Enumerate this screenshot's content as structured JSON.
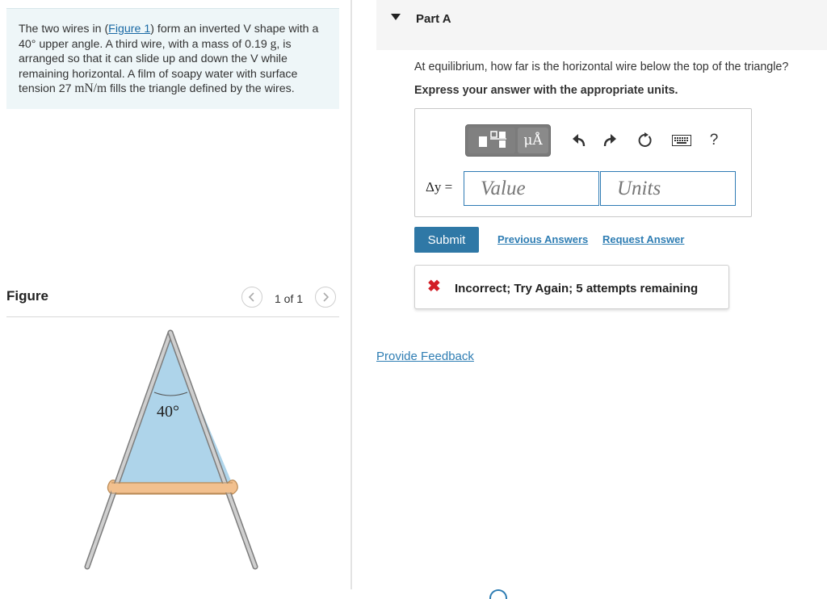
{
  "problem": {
    "text_before_link": "The two wires in (",
    "link_text": "Figure 1",
    "text_after_link": ") form an inverted V shape with a 40° upper angle. A third wire, with a mass of 0.19 ",
    "mass_unit": "g",
    "text_mid": ", is arranged so that it can slide up and down the V while remaining horizontal. A film of soapy water with surface tension 27 ",
    "tension_unit": "mN/m",
    "text_end": " fills the triangle defined by the wires."
  },
  "figure": {
    "title": "Figure",
    "pager": "1 of 1",
    "prev_icon": "chevron-left-icon",
    "next_icon": "chevron-right-icon",
    "angle_label": "40°",
    "colors": {
      "film": "#aed4ea",
      "wire": "#8c8c8c",
      "horizontal_wire": "#f2c08e"
    }
  },
  "part": {
    "title": "Part A",
    "question": "At equilibrium, how far is the horizontal wire below the top of the triangle?",
    "instruction": "Express your answer with the appropriate units."
  },
  "toolbar": {
    "template_icon": "templates-icon",
    "units_button": "μÅ",
    "undo_icon": "undo-icon",
    "redo_icon": "redo-icon",
    "reset_icon": "reset-icon",
    "keyboard_icon": "keyboard-icon",
    "help_label": "?"
  },
  "answer": {
    "variable_label": "Δy =",
    "value_placeholder": "Value",
    "units_placeholder": "Units"
  },
  "actions": {
    "submit": "Submit",
    "previous_answers": "Previous Answers",
    "request_answer": "Request Answer"
  },
  "feedback": {
    "icon": "x-icon",
    "message": "Incorrect; Try Again; 5 attempts remaining"
  },
  "provide_feedback": "Provide Feedback",
  "colors": {
    "accent": "#2f78a6",
    "link": "#2e7db3",
    "error": "#d21e26",
    "panel": "#eef6f8"
  }
}
